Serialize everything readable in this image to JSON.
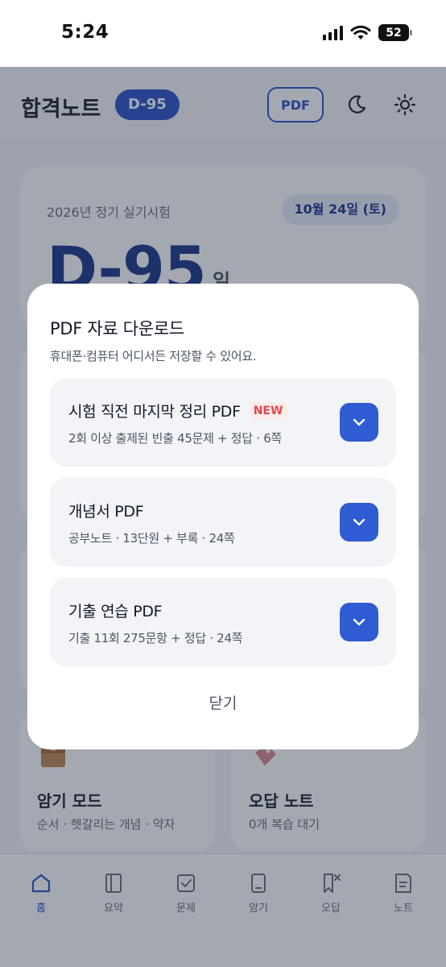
{
  "status_bar": {
    "time": "5:24",
    "battery": "52"
  },
  "header": {
    "title": "합격노트",
    "dday_chip": "D-95",
    "pdf_button": "PDF"
  },
  "exam_card": {
    "label": "2026년 정기 실기시험",
    "date": "10월 24일 (토)",
    "dday": "D-95",
    "dday_unit": "일"
  },
  "mode_cards": [
    {
      "title": "암기 모드",
      "subtitle": "순서 · 헷갈리는 개념 · 약자"
    },
    {
      "title": "오답 노트",
      "subtitle": "0개 복습 대기"
    }
  ],
  "bottom_nav": [
    {
      "label": "홈",
      "icon": "home-icon",
      "active": true
    },
    {
      "label": "요약",
      "icon": "book-icon",
      "active": false
    },
    {
      "label": "문제",
      "icon": "checkbox-icon",
      "active": false
    },
    {
      "label": "암기",
      "icon": "card-icon",
      "active": false
    },
    {
      "label": "오답",
      "icon": "bookmark-x-icon",
      "active": false
    },
    {
      "label": "노트",
      "icon": "note-icon",
      "active": false
    }
  ],
  "modal": {
    "title": "PDF 자료 다운로드",
    "subtitle": "휴대폰·컴퓨터 어디서든 저장할 수 있어요.",
    "items": [
      {
        "title": "시험 직전 마지막 정리 PDF",
        "badge": "NEW",
        "meta": "2회 이상 출제된 빈출 45문제 + 정답 · 6쪽"
      },
      {
        "title": "개념서 PDF",
        "badge": "",
        "meta": "공부노트 · 13단원 + 부록 · 24쪽"
      },
      {
        "title": "기출 연습 PDF",
        "badge": "",
        "meta": "기출 11회 275문항 + 정답 · 24쪽"
      }
    ],
    "close_label": "닫기"
  },
  "colors": {
    "accent": "#2f5bd3",
    "badge_red": "#e5484d",
    "overlay": "rgba(28,38,60,0.40)"
  }
}
